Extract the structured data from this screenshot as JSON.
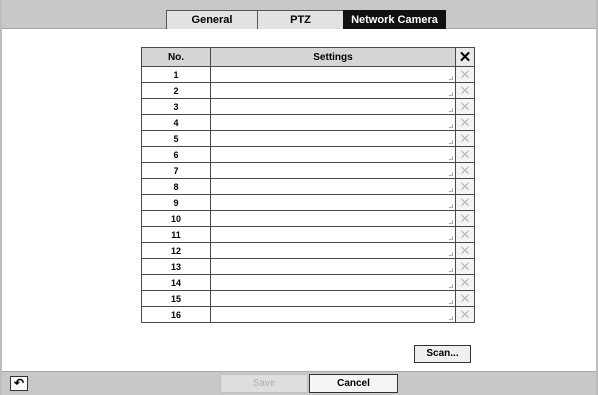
{
  "tabs": [
    {
      "label": "General"
    },
    {
      "label": "PTZ"
    },
    {
      "label": "Network Camera"
    }
  ],
  "table": {
    "headers": {
      "no": "No.",
      "settings": "Settings",
      "delete_glyph": "✕"
    },
    "rows": [
      {
        "no": "1",
        "settings": "",
        "delete_glyph": "✕"
      },
      {
        "no": "2",
        "settings": "",
        "delete_glyph": "✕"
      },
      {
        "no": "3",
        "settings": "",
        "delete_glyph": "✕"
      },
      {
        "no": "4",
        "settings": "",
        "delete_glyph": "✕"
      },
      {
        "no": "5",
        "settings": "",
        "delete_glyph": "✕"
      },
      {
        "no": "6",
        "settings": "",
        "delete_glyph": "✕"
      },
      {
        "no": "7",
        "settings": "",
        "delete_glyph": "✕"
      },
      {
        "no": "8",
        "settings": "",
        "delete_glyph": "✕"
      },
      {
        "no": "9",
        "settings": "",
        "delete_glyph": "✕"
      },
      {
        "no": "10",
        "settings": "",
        "delete_glyph": "✕"
      },
      {
        "no": "11",
        "settings": "",
        "delete_glyph": "✕"
      },
      {
        "no": "12",
        "settings": "",
        "delete_glyph": "✕"
      },
      {
        "no": "13",
        "settings": "",
        "delete_glyph": "✕"
      },
      {
        "no": "14",
        "settings": "",
        "delete_glyph": "✕"
      },
      {
        "no": "15",
        "settings": "",
        "delete_glyph": "✕"
      },
      {
        "no": "16",
        "settings": "",
        "delete_glyph": "✕"
      }
    ]
  },
  "buttons": {
    "scan": "Scan...",
    "save": "Save",
    "cancel": "Cancel",
    "back_glyph": "↶"
  },
  "icons": {
    "back": "undo-arrow-icon",
    "delete": "close-x-icon"
  },
  "colors": {
    "active_tab_bg": "#111111",
    "bar_bg": "#c8c8c8",
    "disabled_text": "#b0b0b0"
  }
}
